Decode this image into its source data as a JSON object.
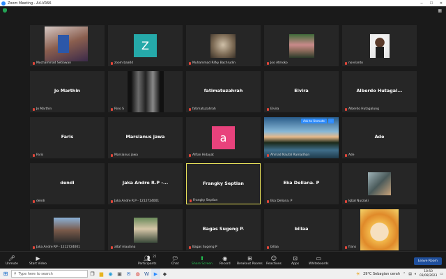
{
  "window": {
    "title": "Zoom Meeting - A4-VR66"
  },
  "view_label": "View",
  "tiles": [
    {
      "name": "Mochammad Setiawan",
      "kind": "photo"
    },
    {
      "name": "zoom baa04",
      "kind": "avatar",
      "letter": "Z",
      "color": "#25a9a9"
    },
    {
      "name": "Muhammad Rifky Bachrudin",
      "kind": "photo"
    },
    {
      "name": "Joo Atmoko",
      "kind": "photo"
    },
    {
      "name": "novrianto",
      "kind": "photo"
    },
    {
      "name": "Jo Marthin",
      "kind": "text",
      "big": "Jo Marthin"
    },
    {
      "name": "Rino S",
      "kind": "photo"
    },
    {
      "name": "fatimatuzahrah",
      "kind": "text",
      "big": "fatimatuzahrah"
    },
    {
      "name": "Elvira",
      "kind": "text",
      "big": "Elvira"
    },
    {
      "name": "Alberdo Hutagalung",
      "kind": "text",
      "big": "Alberdo Hutagal..."
    },
    {
      "name": "Faris",
      "kind": "text",
      "big": "Faris"
    },
    {
      "name": "Marsianus jawa",
      "kind": "text",
      "big": "Marsianus jawa"
    },
    {
      "name": "Alfian Hidayat",
      "kind": "avatar",
      "letter": "a",
      "color": "#e8427c"
    },
    {
      "name": "Ahmad Naufal Ramadhan",
      "kind": "photo",
      "ask": "Ask to Unmute",
      "more": "···"
    },
    {
      "name": "Ade",
      "kind": "text",
      "big": "Ade"
    },
    {
      "name": "dendi",
      "kind": "text",
      "big": "dendi"
    },
    {
      "name": "Jaka Andre R.P - 1212724001",
      "kind": "text",
      "big": "Jaka Andre R.P -..."
    },
    {
      "name": "Frangky Septian",
      "kind": "text",
      "big": "Frangky Septian",
      "speaking": true
    },
    {
      "name": "Eka Deliana. P",
      "kind": "text",
      "big": "Eka Deliana. P"
    },
    {
      "name": "Iqbal Nurzaki",
      "kind": "photo"
    },
    {
      "name": "Jaka Andre RP - 1212724001",
      "kind": "photo"
    },
    {
      "name": "altaf maulana",
      "kind": "photo"
    },
    {
      "name": "Bagas Sugeng P",
      "kind": "text",
      "big": "Bagas Sugeng P."
    },
    {
      "name": "billaa",
      "kind": "text",
      "big": "billaa"
    },
    {
      "name": "frans",
      "kind": "photo"
    }
  ],
  "toolbar": {
    "unmute": "Unmute",
    "start_video": "Start Video",
    "participants": "Participants",
    "participants_count": "25",
    "chat": "Chat",
    "share": "Share Screen",
    "record": "Record",
    "breakout": "Breakout Rooms",
    "reactions": "Reactions",
    "apps": "Apps",
    "whiteboards": "Whiteboards",
    "leave": "Leave Room"
  },
  "taskbar": {
    "search_placeholder": "Type here to search",
    "weather": "29°C  Sebagian cerah",
    "time": "18:50",
    "date": "03/08/2023"
  }
}
